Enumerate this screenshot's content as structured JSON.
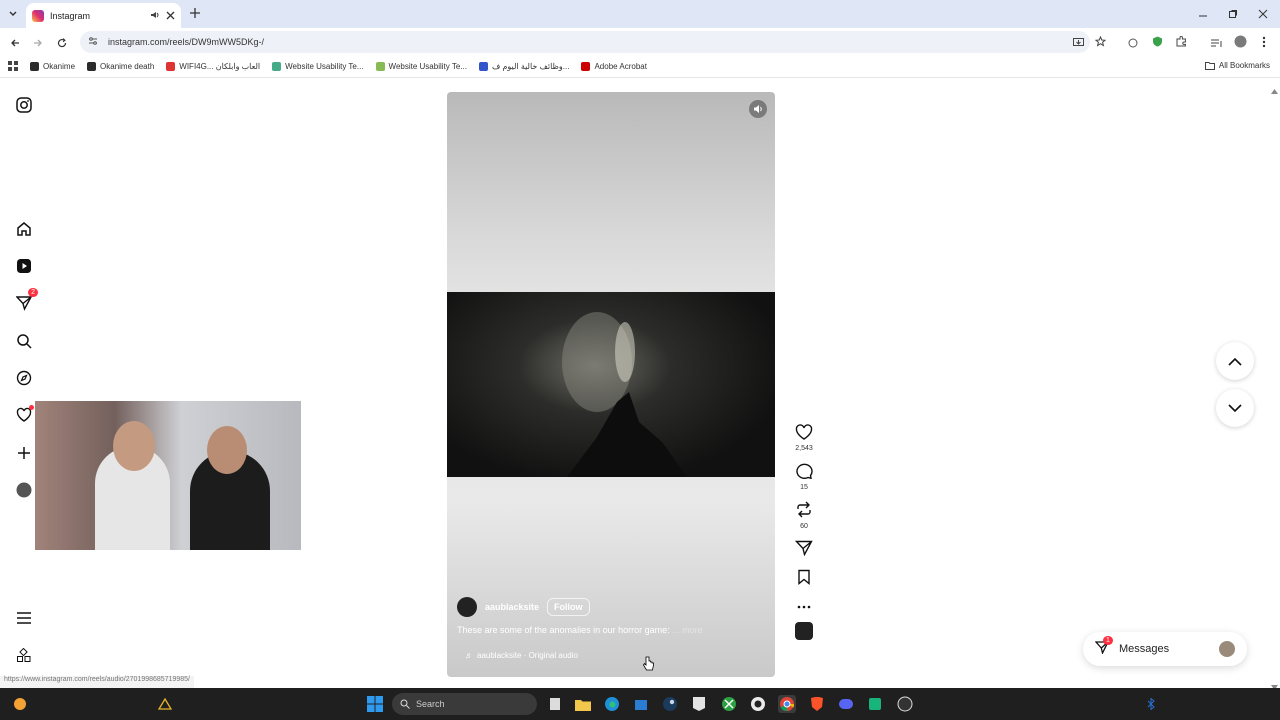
{
  "browser": {
    "tab_title": "Instagram",
    "url": "instagram.com/reels/DW9mWW5DKg-/",
    "bookmarks": [
      {
        "label": "Okanime",
        "color": "#2b2b2b"
      },
      {
        "label": "Okanime death",
        "color": "#2b2b2b"
      },
      {
        "label": "WIFI4G... العاب وابلكان",
        "color": "#d33"
      },
      {
        "label": "Website Usability Te...",
        "color": "#4a8"
      },
      {
        "label": "Website Usability Te...",
        "color": "#8b5"
      },
      {
        "label": "وظائف خالية اليوم ف...",
        "color": "#35c"
      },
      {
        "label": "Adobe Acrobat",
        "color": "#c00"
      }
    ],
    "all_bookmarks": "All Bookmarks",
    "status_url": "https://www.instagram.com/reels/audio/2701998685719985/"
  },
  "reel": {
    "username": "aaublacksite",
    "follow_label": "Follow",
    "caption": "These are some of the anomalies in our horror game:",
    "more": "... more",
    "audio": "aaublacksite · Original audio",
    "likes": "2,543",
    "comments": "15",
    "reposts": "60"
  },
  "sidebar": {
    "notifications_badge": "2"
  },
  "messages": {
    "label": "Messages",
    "badge": "1"
  },
  "taskbar": {
    "search_placeholder": "Search"
  },
  "colors": {
    "accent": "#ff3040",
    "taskbar": "#1f1f1f"
  }
}
